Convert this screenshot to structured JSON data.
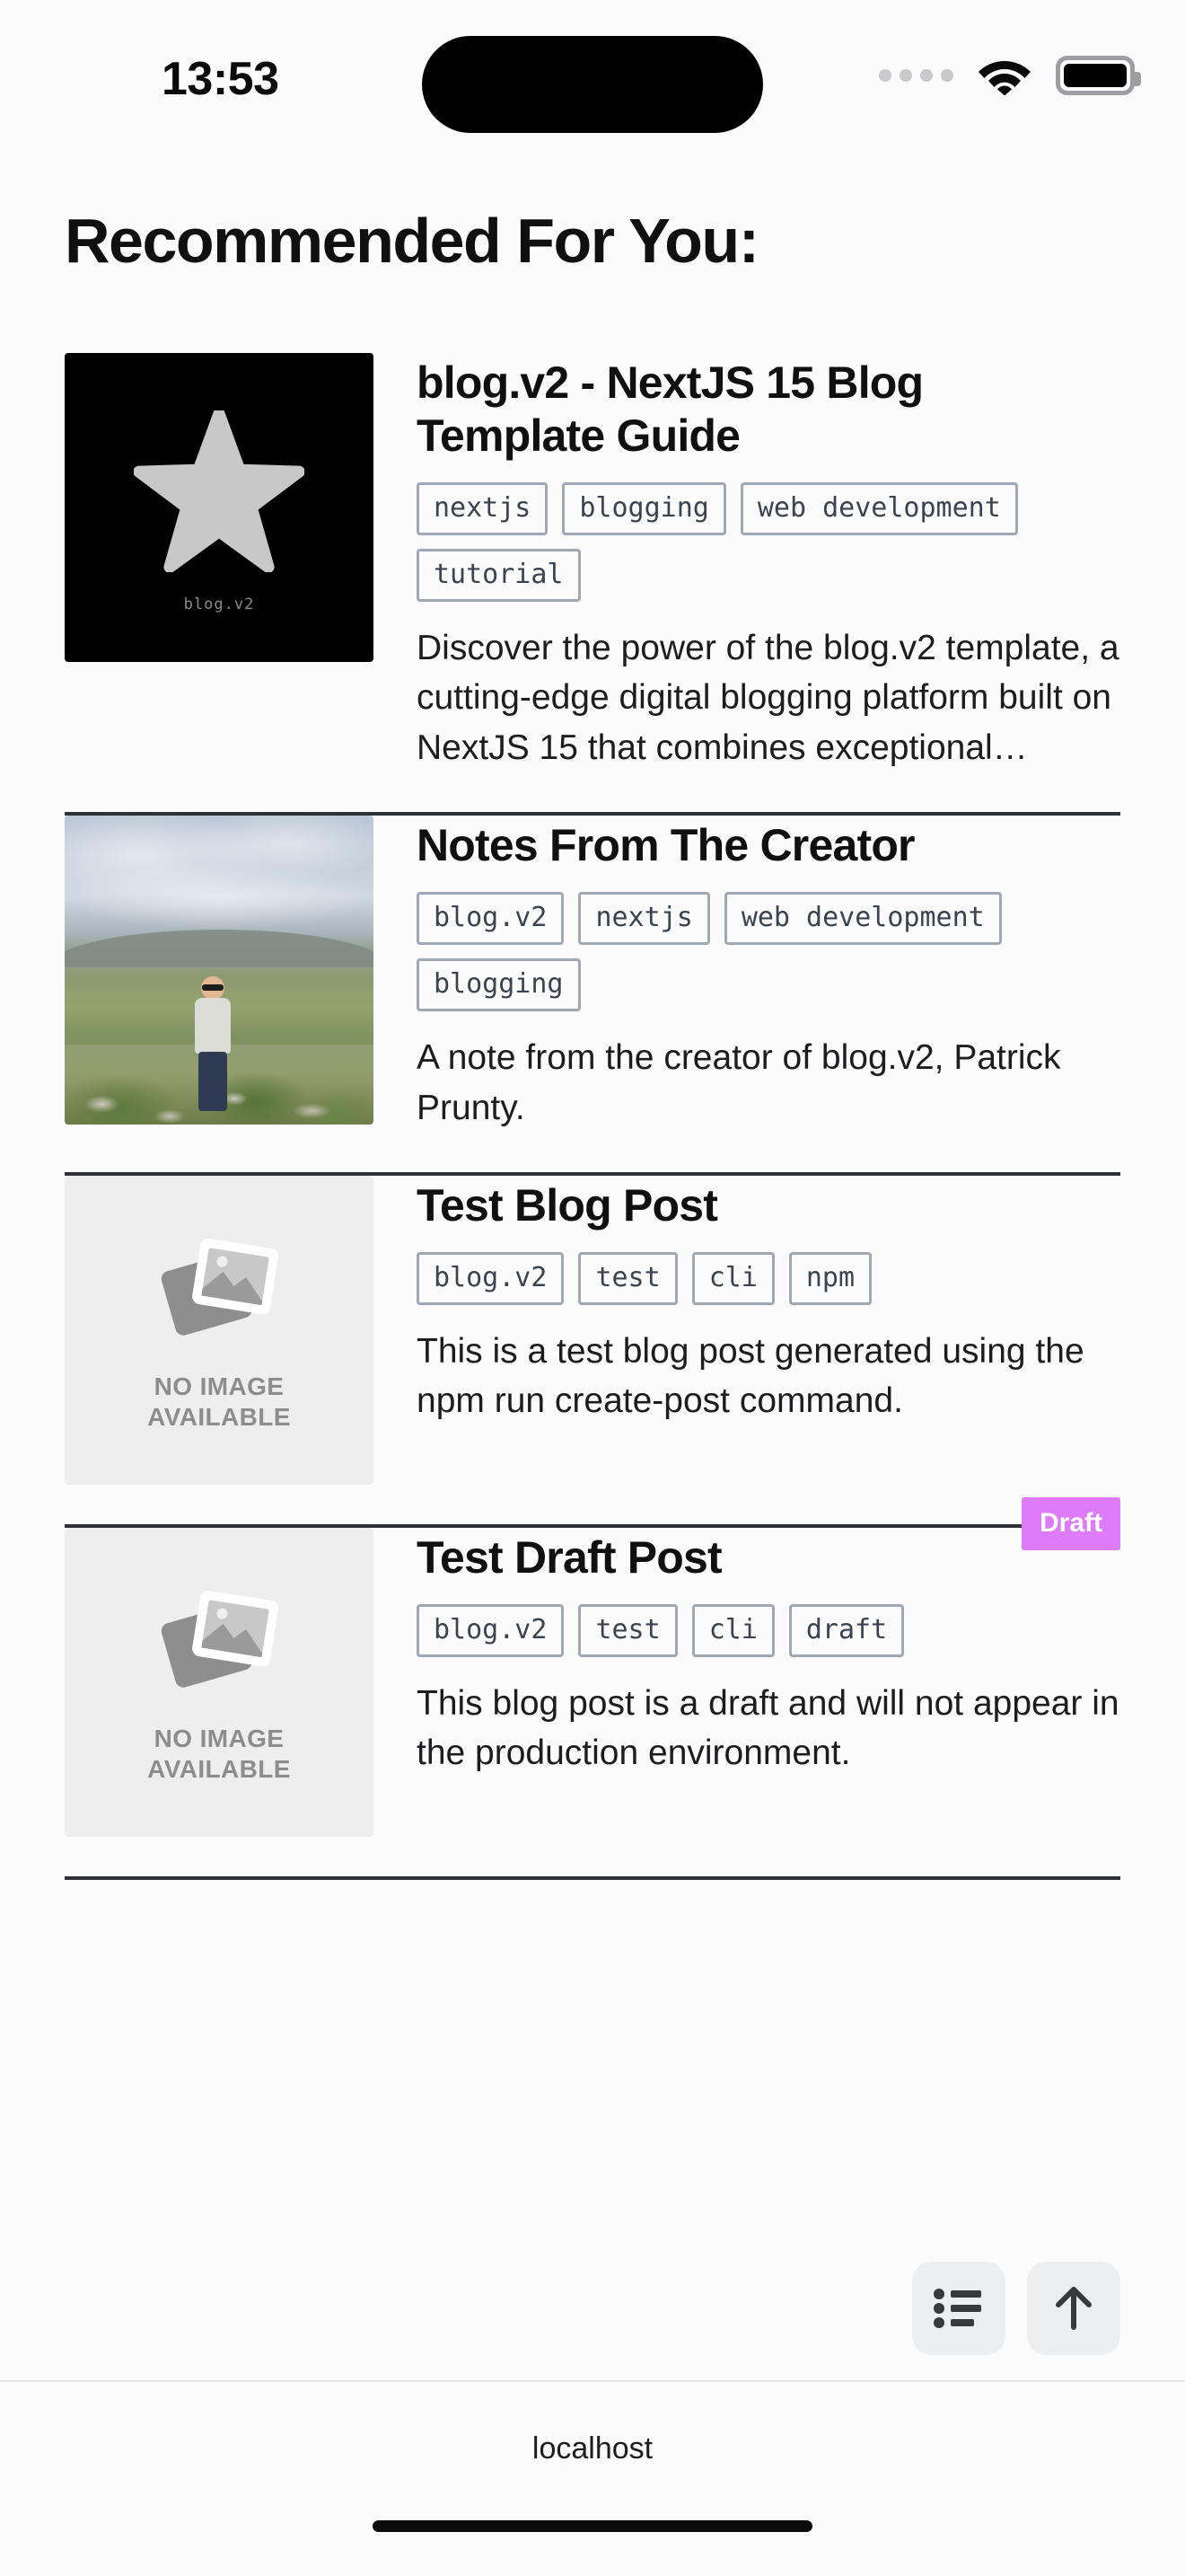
{
  "status_bar": {
    "time": "13:53",
    "signal_icon": "signal-dots-icon",
    "wifi_icon": "wifi-icon",
    "battery_icon": "battery-full-icon"
  },
  "page": {
    "title": "Recommended For You:"
  },
  "posts": [
    {
      "title": "blog.v2 - NextJS 15 Blog Template Guide",
      "tags": [
        "nextjs",
        "blogging",
        "web development",
        "tutorial"
      ],
      "excerpt": "Discover the power of the blog.v2 template, a cutting-edge digital blogging platform built on NextJS 15 that combines exceptional…",
      "thumbnail_type": "logo",
      "thumbnail_caption": "blog.v2",
      "badge": ""
    },
    {
      "title": "Notes From The Creator",
      "tags": [
        "blog.v2",
        "nextjs",
        "web development",
        "blogging"
      ],
      "excerpt": "A note from the creator of blog.v2, Patrick Prunty.",
      "thumbnail_type": "photo",
      "thumbnail_caption": "",
      "badge": ""
    },
    {
      "title": "Test Blog Post",
      "tags": [
        "blog.v2",
        "test",
        "cli",
        "npm"
      ],
      "excerpt": "This is a test blog post generated using the npm run create-post command.",
      "thumbnail_type": "placeholder",
      "thumbnail_caption": "NO IMAGE\nAVAILABLE",
      "badge": ""
    },
    {
      "title": "Test Draft Post",
      "tags": [
        "blog.v2",
        "test",
        "cli",
        "draft"
      ],
      "excerpt": "This blog post is a draft and will not appear in the production environment.",
      "thumbnail_type": "placeholder",
      "thumbnail_caption": "NO IMAGE\nAVAILABLE",
      "badge": "Draft"
    }
  ],
  "placeholder_text": {
    "line1": "NO IMAGE",
    "line2": "AVAILABLE"
  },
  "floating_buttons": [
    {
      "icon": "list-bullet-icon",
      "label": "Table of contents"
    },
    {
      "icon": "arrow-up-icon",
      "label": "Scroll to top"
    }
  ],
  "browser": {
    "url": "localhost"
  },
  "colors": {
    "background": "#fbfbfb",
    "text": "#101010",
    "tag_border": "#9fa8b4",
    "tag_text": "#3b4350",
    "separator": "#2e3237",
    "draft_badge_bg": "#dd7bfa",
    "draft_badge_text": "#ffffff",
    "placeholder_bg": "#eeeeee",
    "placeholder_text": "#8d8d8d",
    "fab_bg": "#eceef0"
  }
}
